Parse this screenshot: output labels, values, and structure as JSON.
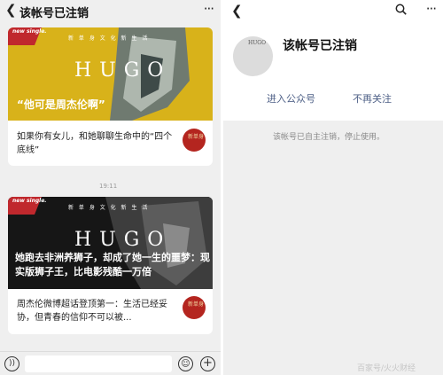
{
  "left": {
    "title": "该帐号已注销",
    "timestamp": "19:11",
    "cards": [
      {
        "tag": "new single.",
        "issue_line": "新 单 身 文 化 新 生 活",
        "logo": "HUGO",
        "headline": "“他可是周杰伦啊”",
        "summary": "如果你有女儿，和她聊聊生命中的“四个底线”",
        "thumb_text": "新单身"
      },
      {
        "tag": "new single.",
        "issue_line": "新 单 身 文 化 新 生 活",
        "logo": "HUGO",
        "headline": "她跑去非洲养狮子，却成了她一生的噩梦：现实版狮子王，比电影残酷一万倍",
        "summary": "周杰伦微博超话登顶第一：生活已经妥协，但青春的信仰不可以被...",
        "thumb_text": "新单身"
      }
    ]
  },
  "right": {
    "name": "该帐号已注销",
    "avatar_text": "HUGO",
    "enter_button": "进入公众号",
    "unfollow_button": "不再关注",
    "notice": "该帐号已自主注销，停止使用。",
    "watermark": "百家号/火火财经"
  },
  "colors": {
    "banner1": "#d8b21a",
    "banner2": "#161616",
    "tag_red": "#c0282d",
    "link_blue": "#4d5f86"
  },
  "icons": [
    "back-icon",
    "more-icon",
    "search-icon",
    "voice-icon",
    "emoji-icon",
    "plus-icon"
  ]
}
